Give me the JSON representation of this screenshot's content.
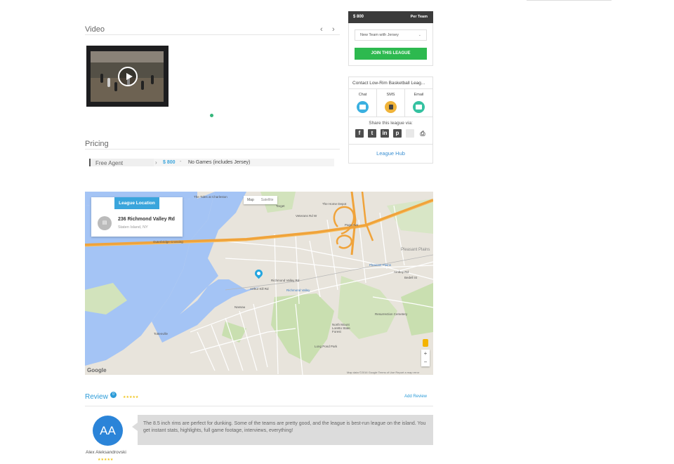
{
  "video": {
    "title": "Video",
    "prev": "‹",
    "next": "›"
  },
  "pricing": {
    "title": "Pricing",
    "rows": [
      {
        "name": "Free Agent",
        "arrow": "›",
        "amount": "$ 800",
        "dash": "-",
        "description": "No Games (includes Jersey)"
      }
    ]
  },
  "purchase": {
    "price": "$ 800",
    "unit": "Per Team",
    "option_selected": "New Team with Jersey",
    "join_label": "JOIN THIS LEAGUE",
    "join_color": "#2db94f"
  },
  "contact": {
    "title": "Contact Low-Rim Basketball Leag...",
    "methods": [
      {
        "label": "Chat",
        "icon": "chat-icon",
        "color": "#3bb0e0"
      },
      {
        "label": "SMS",
        "icon": "sms-icon",
        "color": "#f0b43a"
      },
      {
        "label": "Email",
        "icon": "email-icon",
        "color": "#35c2a1"
      }
    ],
    "share_label": "Share this league via:",
    "share_icons": [
      "facebook-icon",
      "twitter-icon",
      "linkedin-icon",
      "pinterest-icon",
      "mail-icon",
      "print-icon"
    ],
    "hub_label": "League Hub"
  },
  "map": {
    "location_tab": "League Location",
    "address": "236 Richmond Valley Rd",
    "city": "Staten Island, NY",
    "type_map": "Map",
    "type_satellite": "Satellite",
    "zoom_in": "+",
    "zoom_out": "−",
    "google": "Google",
    "attribution": "Map data ©2016 Google    Terms of Use    Report a map error",
    "labels": [
      "The Tides at Charleston",
      "Target",
      "The Home Depot",
      "Richmond Valley Rd",
      "Veterans Rd W",
      "Outerbridge Crossing",
      "Pleasant Plains",
      "Richmond Valley",
      "Arthur Kill Rd",
      "Nassau",
      "Tottenville",
      "Page Ave",
      "Amboy Rd",
      "Resurrection Cemetery",
      "North Mount Loretto State Forest",
      "Long Pond Park",
      "Pleasant Plains",
      "Bedell St"
    ]
  },
  "review": {
    "title": "Review",
    "count": "0",
    "stars": "★★★★★",
    "add_label": "Add Review",
    "items": [
      {
        "initials": "AA",
        "author": "Alex Aleksandrovski",
        "stars": "★★★★★",
        "text": "The 8.5 inch rims are perfect for dunking. Some of the teams are pretty good, and the league is best-run league on the island. You get instant stats, highlights, full game footage, interviews, everything!"
      }
    ]
  }
}
